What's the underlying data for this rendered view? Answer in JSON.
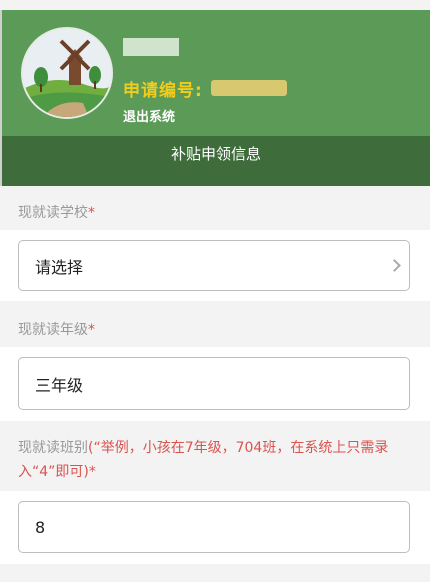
{
  "header": {
    "username": "",
    "application_label": "申请编号:",
    "application_value": "",
    "logout_label": "退出系统"
  },
  "section_title": "补贴申领信息",
  "form": {
    "school": {
      "label": "现就读学校",
      "required_mark": "*",
      "value": "请选择"
    },
    "grade": {
      "label": "现就读年级",
      "required_mark": "*",
      "value": "三年级"
    },
    "class": {
      "label": "现就读班别",
      "hint": "(“举例，小孩在7年级，704班，在系统上只需录入“4”即可)*",
      "value": "8"
    }
  },
  "colors": {
    "header_green": "#5b9a57",
    "tab_green": "#3e6d3b",
    "accent_yellow": "#f2cc1c",
    "required_red": "#d9534f"
  }
}
